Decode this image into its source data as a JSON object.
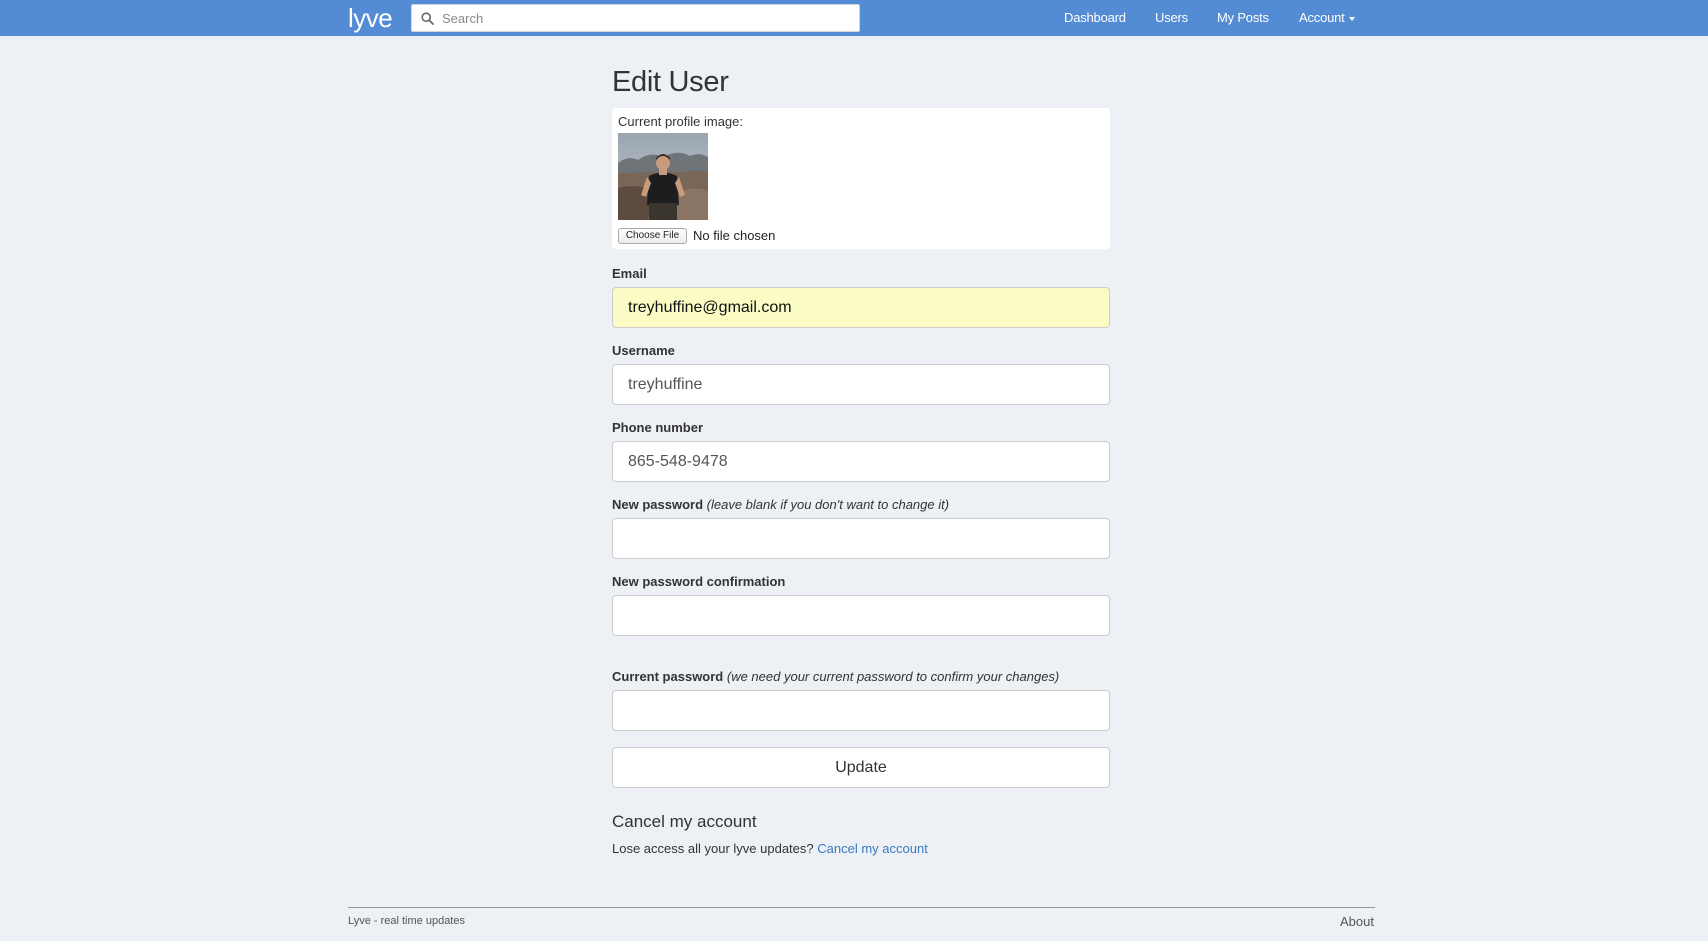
{
  "navbar": {
    "brand": "lyve",
    "search_placeholder": "Search",
    "links": {
      "dashboard": "Dashboard",
      "users": "Users",
      "my_posts": "My Posts",
      "account": "Account"
    }
  },
  "page": {
    "title": "Edit User"
  },
  "profile_image": {
    "label": "Current profile image:",
    "choose_file": "Choose File",
    "file_status": "No file chosen"
  },
  "form": {
    "email": {
      "label": "Email",
      "value": "treyhuffine@gmail.com"
    },
    "username": {
      "label": "Username",
      "value": "treyhuffine"
    },
    "phone": {
      "label": "Phone number",
      "value": "865-548-9478"
    },
    "new_password": {
      "label": "New password",
      "hint": "(leave blank if you don't want to change it)",
      "value": ""
    },
    "new_password_confirmation": {
      "label": "New password confirmation",
      "value": ""
    },
    "current_password": {
      "label": "Current password",
      "hint": "(we need your current password to confirm your changes)",
      "value": ""
    },
    "submit": "Update"
  },
  "cancel": {
    "heading": "Cancel my account",
    "text": "Lose access all your lyve updates?",
    "link": "Cancel my account"
  },
  "footer": {
    "left": "Lyve - real time updates",
    "right": "About"
  },
  "colors": {
    "navbar": "#538bd4",
    "background": "#edf0f5",
    "autofill": "#fafcc4",
    "link": "#3a78c0"
  }
}
